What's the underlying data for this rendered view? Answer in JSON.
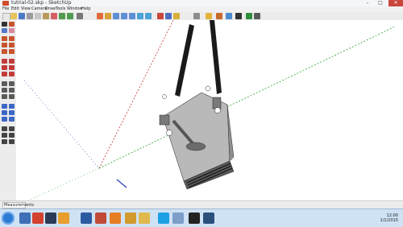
{
  "window": {
    "title": "tutrial-02.skp - SketchUp",
    "controls": {
      "minimize": "–",
      "maximize": "□",
      "close": "✕"
    }
  },
  "menubar": {
    "items": [
      "File",
      "Edit",
      "View",
      "Camera",
      "Draw",
      "Tools",
      "Window",
      "Help"
    ]
  },
  "toolbar": {
    "icons": [
      "new-icon",
      "open-icon",
      "save-icon",
      "cut-icon",
      "copy-icon",
      "paste-icon",
      "erase-icon",
      "undo-icon",
      "redo-icon",
      "print-icon",
      "orbit-icon",
      "pan-icon",
      "zoom-icon",
      "zoom-window-icon",
      "zoom-extents-icon",
      "previous-icon",
      "next-icon",
      "materials-icon",
      "components-icon",
      "warehouse-icon",
      "extension-icon"
    ]
  },
  "left_tools": {
    "icons": [
      "select-icon",
      "make-component-icon",
      "paint-bucket-icon",
      "eraser-icon",
      "rectangle-icon",
      "line-icon",
      "circle-icon",
      "arc-icon",
      "polygon-icon",
      "freehand-icon",
      "move-icon",
      "push-pull-icon",
      "rotate-icon",
      "follow-me-icon",
      "scale-icon",
      "offset-icon",
      "tape-measure-icon",
      "dimension-icon",
      "protractor-icon",
      "text-icon",
      "axes-icon",
      "3d-text-icon",
      "orbit-icon",
      "pan-icon",
      "zoom-icon",
      "walk-icon",
      "look-around-icon",
      "position-camera-icon",
      "section-plane-icon"
    ]
  },
  "statusbar": {
    "measurements_value": "Measurements"
  },
  "taskbar": {
    "apps": [
      "explorer-icon",
      "chrome-icon",
      "steam-icon",
      "media-player-icon",
      "word-icon",
      "sketchup-icon",
      "firefox-icon",
      "paint-icon",
      "folder-icon",
      "skype-icon",
      "notepad-icon",
      "cmd-icon",
      "photoshop-icon"
    ],
    "clock_time": "12:00",
    "clock_date": "1/1/2015"
  },
  "colors": {
    "axis_red": "#c43333",
    "axis_green": "#2fa32f",
    "axis_blue": "#2a3fb8",
    "model_gray": "#b9b9b9",
    "model_dark": "#1a1a1a"
  }
}
